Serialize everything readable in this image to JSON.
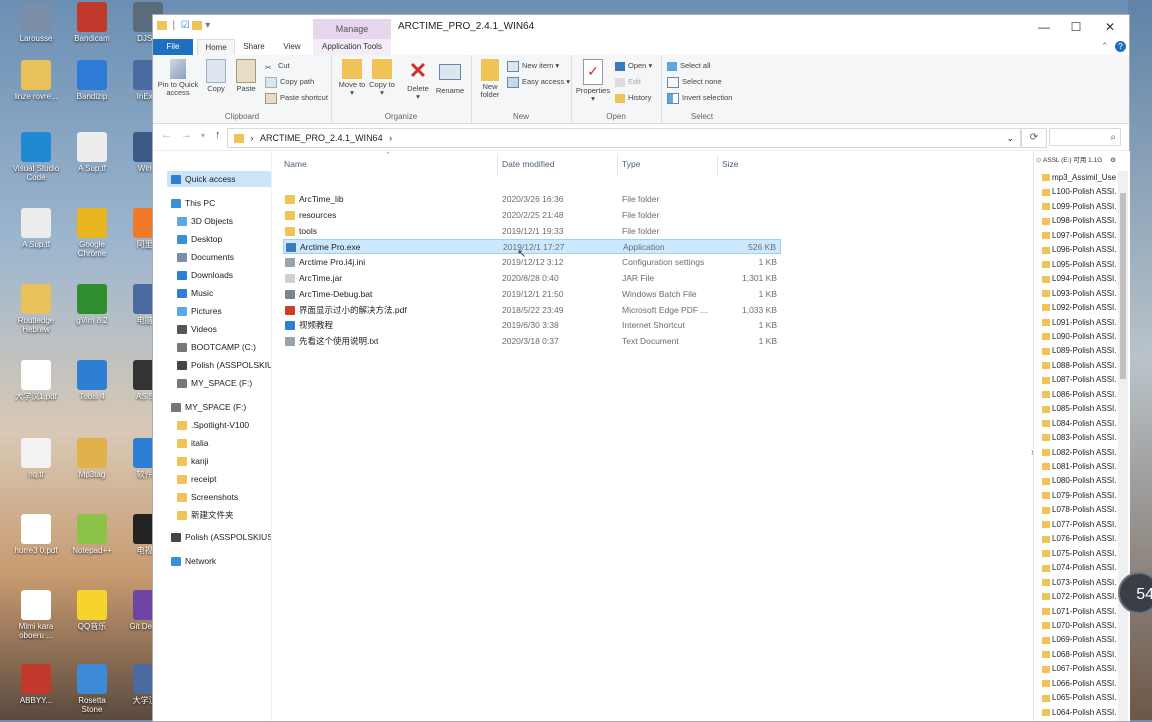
{
  "desktop": {
    "icons": [
      {
        "label": "Larousse",
        "color": "#7a8ea7"
      },
      {
        "label": "Bandicam",
        "color": "#c0392b"
      },
      {
        "label": "DJS...",
        "color": "#5a6b7c"
      },
      {
        "label": "linze rovre...",
        "color": "#e8c15a"
      },
      {
        "label": "Bandizip",
        "color": "#2e7bd6"
      },
      {
        "label": "InEx...",
        "color": "#4b6aa0"
      },
      {
        "label": "Visual Studio Code",
        "color": "#1f8ad2"
      },
      {
        "label": "A Sup.tf",
        "color": "#ededed"
      },
      {
        "label": "Win...",
        "color": "#3b5b86"
      },
      {
        "label": "A Sup.tf",
        "color": "#ececec"
      },
      {
        "label": "Google Chrome",
        "color": "#e9b51f"
      },
      {
        "label": "阿里...",
        "color": "#f07a2a"
      },
      {
        "label": "Routledge Hebrew",
        "color": "#e8c15a"
      },
      {
        "label": "gVim 8.2",
        "color": "#2f8f2f"
      },
      {
        "label": "电脑...",
        "color": "#4b6aa0"
      },
      {
        "label": "大学汉1.pdf",
        "color": "#ffffff"
      },
      {
        "label": "Tools 4",
        "color": "#2d7fd3"
      },
      {
        "label": "AS 5...",
        "color": "#333333"
      },
      {
        "label": "hq.tf",
        "color": "#f2f2f2"
      },
      {
        "label": "Mp3tag",
        "color": "#e1b14b"
      },
      {
        "label": "软件...",
        "color": "#2d7fd3"
      },
      {
        "label": "hurre3 0.pdf",
        "color": "#ffffff"
      },
      {
        "label": "Notepad++",
        "color": "#8bc34a"
      },
      {
        "label": "电视...",
        "color": "#222222"
      },
      {
        "label": "Mimi kara oboeru ...",
        "color": "#ffffff"
      },
      {
        "label": "QQ音乐",
        "color": "#f7d42c"
      },
      {
        "label": "Git Desk...",
        "color": "#6e44a5"
      },
      {
        "label": "ABBYY...",
        "color": "#c0392b"
      },
      {
        "label": "Rosetta Stone",
        "color": "#3c8ad8"
      },
      {
        "label": "大学汉...",
        "color": "#4b6aa0"
      }
    ],
    "overlay_percent": "54"
  },
  "window": {
    "title": "ARCTIME_PRO_2.4.1_WIN64",
    "manage_label": "Manage",
    "minimize": "—",
    "maximize": "☐",
    "close": "✕"
  },
  "tabs": {
    "file": "File",
    "home": "Home",
    "share": "Share",
    "view": "View",
    "app_tools": "Application Tools"
  },
  "ribbon": {
    "clipboard": {
      "label": "Clipboard",
      "pin": "Pin to Quick access",
      "copy": "Copy",
      "paste": "Paste",
      "cut": "Cut",
      "copy_path": "Copy path",
      "paste_shortcut": "Paste shortcut"
    },
    "organize": {
      "label": "Organize",
      "move_to": "Move to",
      "copy_to": "Copy to",
      "delete": "Delete",
      "rename": "Rename"
    },
    "new": {
      "label": "New",
      "new_folder": "New folder",
      "new_item": "New item",
      "easy_access": "Easy access"
    },
    "open": {
      "label": "Open",
      "properties": "Properties",
      "open": "Open",
      "edit": "Edit",
      "history": "History"
    },
    "select": {
      "label": "Select",
      "select_all": "Select all",
      "select_none": "Select none",
      "invert": "Invert selection"
    }
  },
  "address": {
    "path": "ARCTIME_PRO_2.4.1_WIN64"
  },
  "nav": {
    "items": [
      {
        "label": "Quick access",
        "color": "#2d7fd3"
      },
      {
        "label": "This PC",
        "color": "#3a8fd8"
      },
      {
        "label": "3D Objects",
        "color": "#5aa9e6"
      },
      {
        "label": "Desktop",
        "color": "#3a8fd8"
      },
      {
        "label": "Documents",
        "color": "#7a8ea7"
      },
      {
        "label": "Downloads",
        "color": "#2d7fd3"
      },
      {
        "label": "Music",
        "color": "#2d7fd3"
      },
      {
        "label": "Pictures",
        "color": "#5aa9e6"
      },
      {
        "label": "Videos",
        "color": "#555555"
      },
      {
        "label": "BOOTCAMP (C:)",
        "color": "#777777"
      },
      {
        "label": "Polish (ASSPOLSKIU",
        "color": "#444444"
      },
      {
        "label": "MY_SPACE (F:)",
        "color": "#777777"
      },
      {
        "label": "MY_SPACE (F:)",
        "color": "#777777"
      },
      {
        "label": ".Spotlight-V100",
        "color": "#f1c255"
      },
      {
        "label": "italia",
        "color": "#f1c255"
      },
      {
        "label": "kanji",
        "color": "#f1c255"
      },
      {
        "label": "receipt",
        "color": "#f1c255"
      },
      {
        "label": "Screenshots",
        "color": "#f1c255"
      },
      {
        "label": "新建文件夹",
        "color": "#f1c255"
      },
      {
        "label": "Polish (ASSPOLSKIUS",
        "color": "#444444"
      },
      {
        "label": "Network",
        "color": "#3a8fd8"
      }
    ]
  },
  "files": {
    "columns": {
      "name": "Name",
      "date": "Date modified",
      "type": "Type",
      "size": "Size"
    },
    "rows": [
      {
        "name": "ArcTime_lib",
        "date": "2020/3/26 16:36",
        "type": "File folder",
        "size": "",
        "color": "#f1c255"
      },
      {
        "name": "resources",
        "date": "2020/2/25 21:48",
        "type": "File folder",
        "size": "",
        "color": "#f1c255"
      },
      {
        "name": "tools",
        "date": "2019/12/1 19:33",
        "type": "File folder",
        "size": "",
        "color": "#f1c255"
      },
      {
        "name": "Arctime Pro.exe",
        "date": "2019/12/1 17:27",
        "type": "Application",
        "size": "526 KB",
        "color": "#3a7bbf"
      },
      {
        "name": "Arctime Pro.l4j.ini",
        "date": "2019/12/12 3:12",
        "type": "Configuration settings",
        "size": "1 KB",
        "color": "#9aa3ad"
      },
      {
        "name": "ArcTime.jar",
        "date": "2020/8/28 0:40",
        "type": "JAR File",
        "size": "1,301 KB",
        "color": "#d0d0d0"
      },
      {
        "name": "ArcTime-Debug.bat",
        "date": "2019/12/1 21:50",
        "type": "Windows Batch File",
        "size": "1 KB",
        "color": "#7a8591"
      },
      {
        "name": "界面显示过小的解决方法.pdf",
        "date": "2018/5/22 23:49",
        "type": "Microsoft Edge PDF ...",
        "size": "1,033 KB",
        "color": "#d23a2a"
      },
      {
        "name": "视频教程",
        "date": "2019/6/30 3:38",
        "type": "Internet Shortcut",
        "size": "1 KB",
        "color": "#2d7fd3"
      },
      {
        "name": "先看这个使用说明.txt",
        "date": "2020/3/18 0:37",
        "type": "Text Document",
        "size": "1 KB",
        "color": "#9aa3ad"
      }
    ]
  },
  "rpane": {
    "top": "ASSL (E:) 可用 1.1G",
    "items": [
      "mp3_Assimil_Use",
      "L100-Polish ASSI.",
      "L099-Polish ASSI.",
      "L098-Polish ASSI.",
      "L097-Polish ASSI.",
      "L096-Polish ASSI.",
      "L095-Polish ASSI.",
      "L094-Polish ASSI.",
      "L093-Polish ASSI.",
      "L092-Polish ASSI.",
      "L091-Polish ASSI.",
      "L090-Polish ASSI.",
      "L089-Polish ASSI.",
      "L088-Polish ASSI.",
      "L087-Polish ASSI.",
      "L086-Polish ASSI.",
      "L085-Polish ASSI.",
      "L084-Polish ASSI.",
      "L083-Polish ASSI.",
      "L082-Polish ASSI.",
      "L081-Polish ASSI.",
      "L080-Polish ASSI.",
      "L079-Polish ASSI.",
      "L078-Polish ASSI.",
      "L077-Polish ASSI.",
      "L076-Polish ASSI.",
      "L075-Polish ASSI.",
      "L074-Polish ASSI.",
      "L073-Polish ASSI.",
      "L072-Polish ASSI.",
      "L071-Polish ASSI.",
      "L070-Polish ASSI.",
      "L069-Polish ASSI.",
      "L068-Polish ASSI.",
      "L067-Polish ASSI.",
      "L066-Polish ASSI.",
      "L065-Polish ASSI.",
      "L064-Polish ASSI."
    ]
  }
}
